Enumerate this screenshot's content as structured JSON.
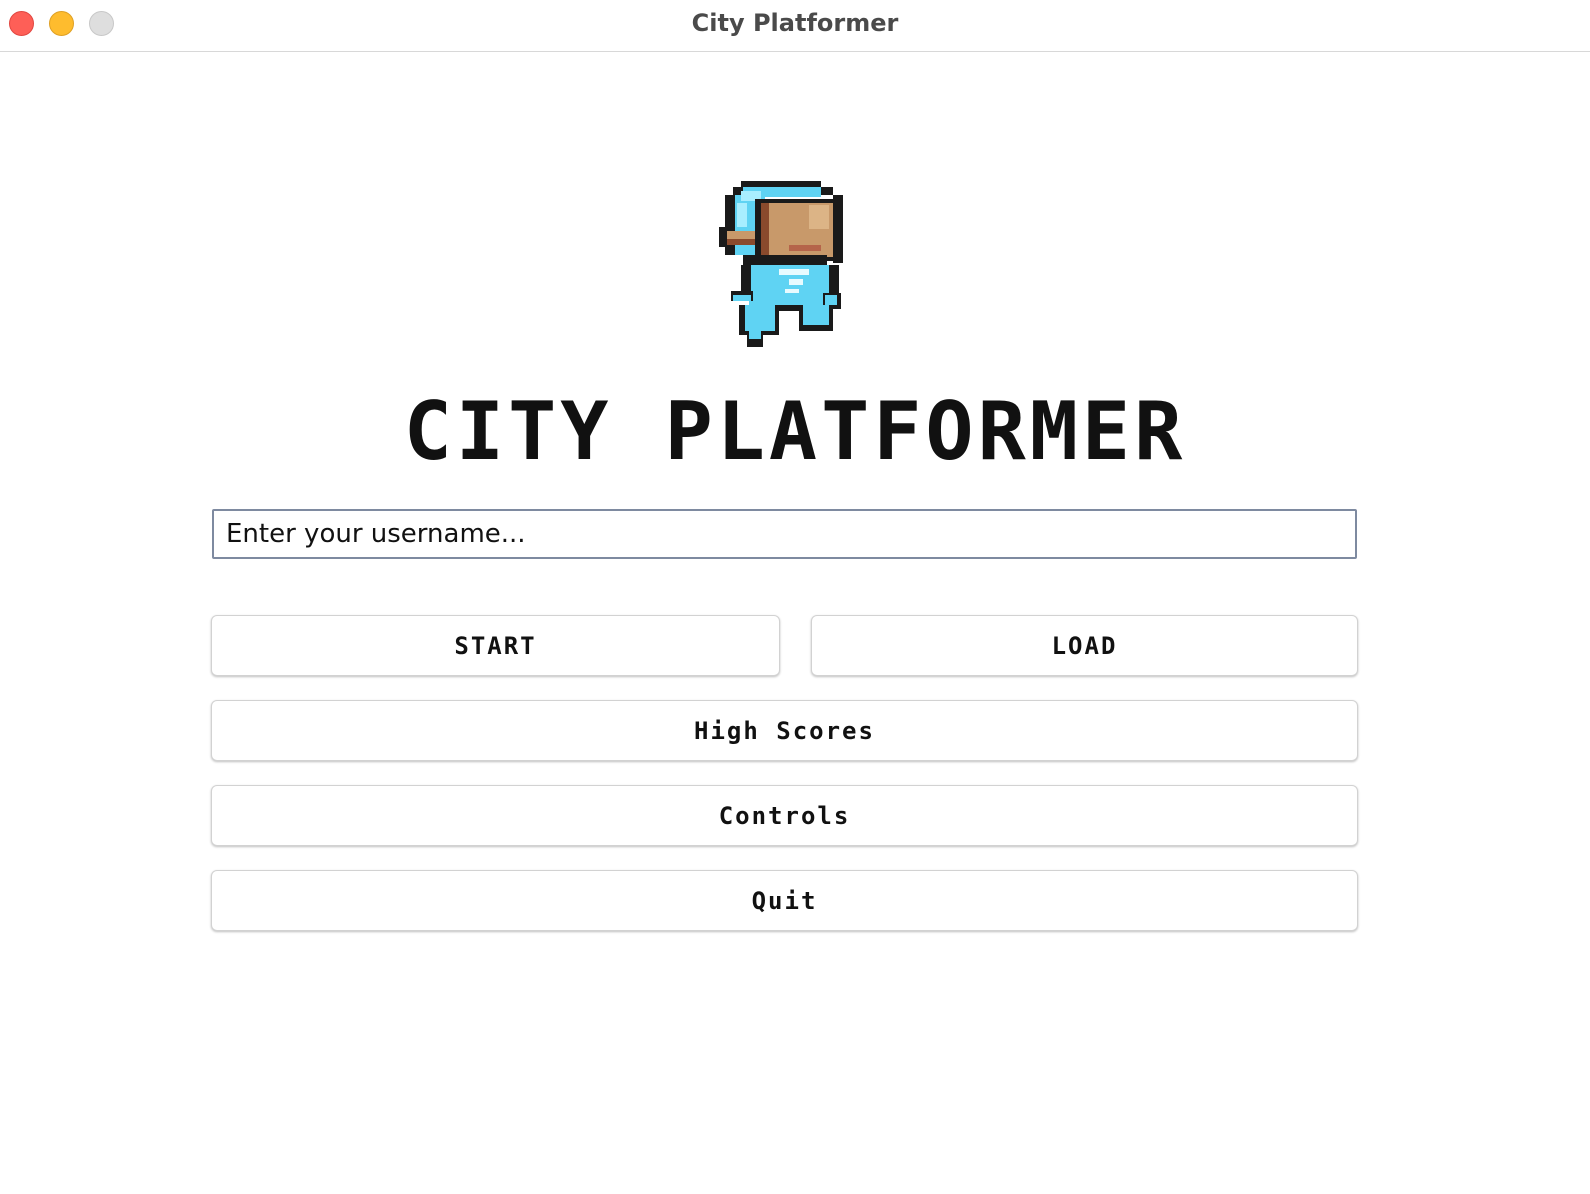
{
  "window": {
    "title": "City Platformer",
    "controls": [
      "close",
      "minimize",
      "zoom"
    ]
  },
  "header": {
    "logo_icon": "astronaut-sprite-icon",
    "game_title": "CITY PLATFORMER"
  },
  "form": {
    "username_placeholder": "Enter your username...",
    "username_value": ""
  },
  "menu": {
    "start_label": "START",
    "load_label": "LOAD",
    "high_scores_label": "High Scores",
    "controls_label": "Controls",
    "quit_label": "Quit"
  },
  "colors": {
    "suit": "#5fd3f3",
    "visor": "#c8996a",
    "outline": "#1a1a1a",
    "close": "#fe5f57",
    "minimize": "#febc2e",
    "zoom": "#dedede"
  }
}
